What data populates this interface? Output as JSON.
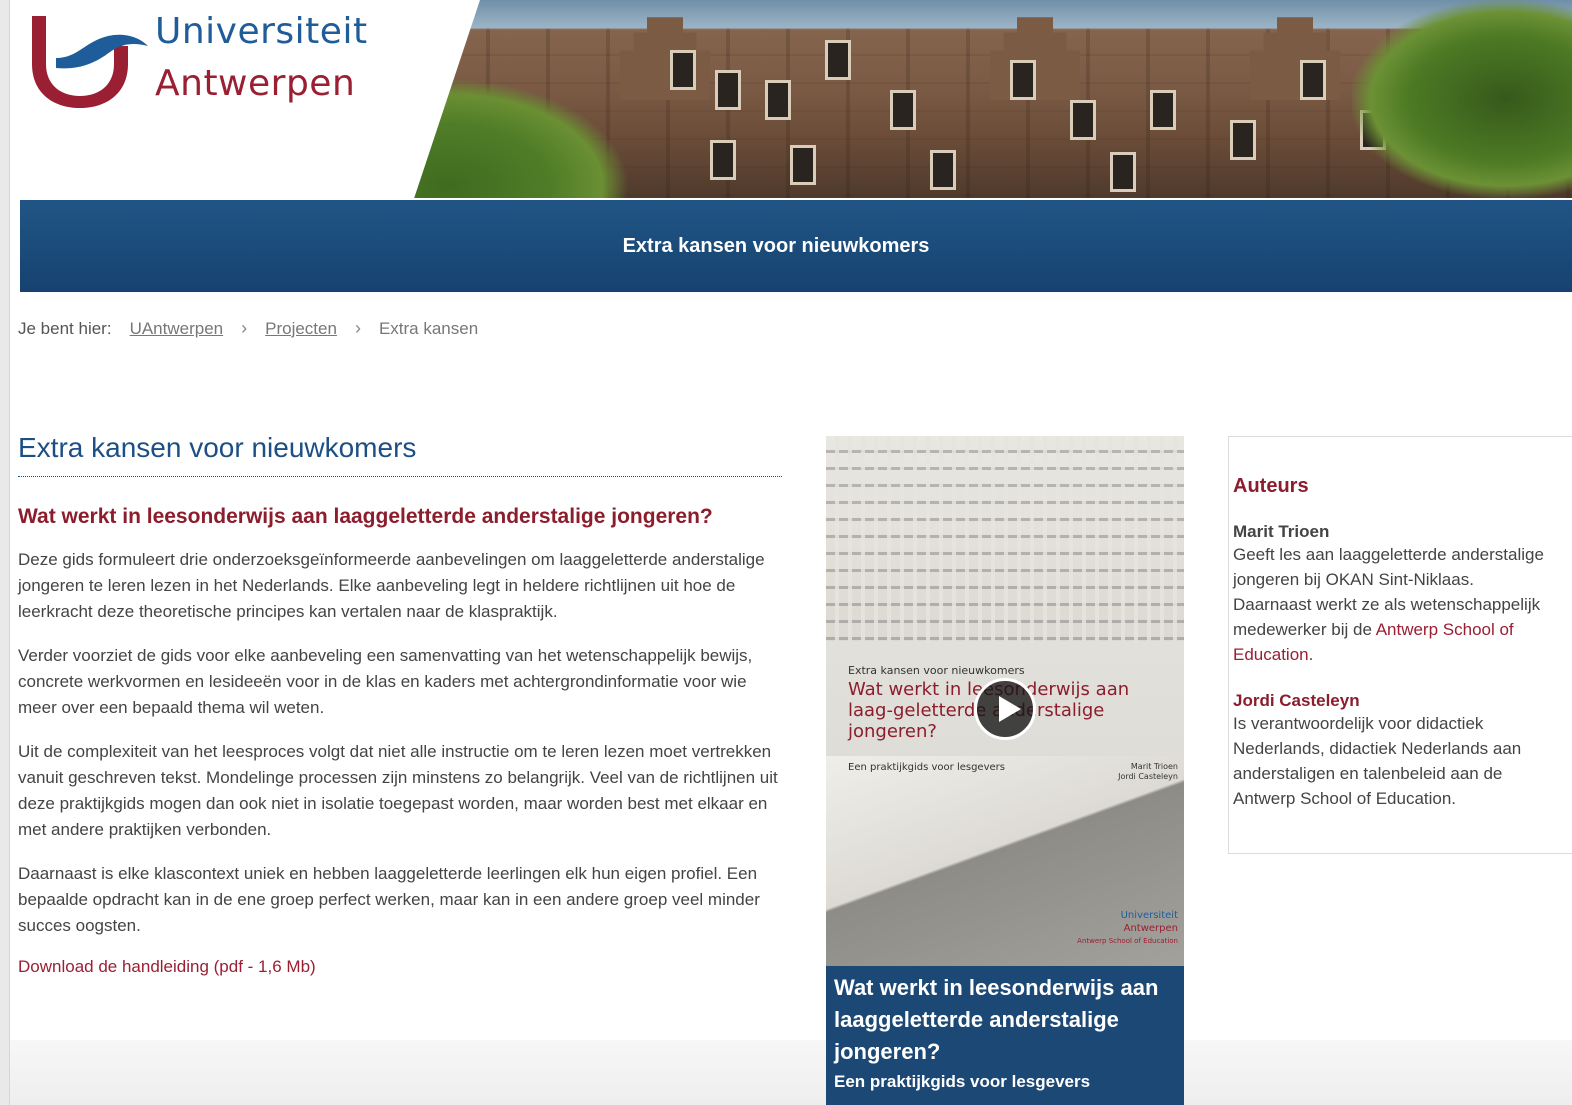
{
  "header": {
    "logo_line1": "Universiteit",
    "logo_line2": "Antwerpen",
    "brand_blue": "#1f5d9a",
    "brand_red": "#9a1f33"
  },
  "titlebar": {
    "title": "Extra kansen voor nieuwkomers",
    "color": "#1c4a78"
  },
  "breadcrumb": {
    "label": "Je bent hier:",
    "items": [
      {
        "label": "UAntwerpen",
        "link": true
      },
      {
        "label": "Projecten",
        "link": true
      },
      {
        "label": "Extra kansen",
        "link": false
      }
    ],
    "separator": "›"
  },
  "main": {
    "title": "Extra kansen voor nieuwkomers",
    "subtitle": "Wat werkt in leesonderwijs aan laaggeletterde anderstalige jongeren?",
    "paragraphs": [
      "Deze gids formuleert drie onderzoeksgeïnformeerde aanbevelingen om laaggeletterde anderstalige jongeren te leren lezen in het Nederlands. Elke aanbeveling legt in heldere richtlijnen uit hoe de leerkracht deze theoretische principes kan vertalen naar de klaspraktijk.",
      "Verder voorziet de gids voor elke aanbeveling een samenvatting van het wetenschappelijk bewijs, concrete werkvormen en lesideeën voor in de klas en kaders met achtergrondinformatie voor wie meer over een bepaald thema wil weten.",
      "Uit de complexiteit van het leesproces volgt dat niet alle instructie om te leren lezen moet vertrekken vanuit geschreven tekst. Mondelinge processen zijn minstens zo belangrijk. Veel van de richtlijnen uit deze praktijkgids mogen dan ook niet in isolatie toegepast worden, maar worden best met elkaar en met andere praktijken verbonden.",
      "Daarnaast is elke klascontext uniek en hebben laaggeletterde leerlingen elk hun eigen profiel. Een bepaalde opdracht kan in de ene groep perfect werken, maar kan in een andere groep veel minder succes oogsten."
    ],
    "download": "Download de handleiding (pdf - 1,6 Mb)"
  },
  "video": {
    "cover_small": "Extra kansen voor nieuwkomers",
    "cover_title": "Wat werkt in leesonderwijs aan laag-geletterde anderstalige jongeren?",
    "cover_guide": "Een praktijkgids voor lesgevers",
    "cover_author1": "Marit Trioen",
    "cover_author2": "Jordi Casteleyn",
    "cover_logo1": "Universiteit",
    "cover_logo2": "Antwerpen",
    "cover_logo3": "Antwerp School of Education",
    "caption_title": "Wat werkt in leesonderwijs aan laaggeletterde anderstalige jongeren?",
    "caption_sub": "Een praktijkgids voor lesgevers",
    "play_icon": "play-icon"
  },
  "aside": {
    "heading": "Auteurs",
    "authors": [
      {
        "name": "Marit Trioen",
        "bio_lines": [
          "Geeft les aan laaggeletterde anderstalige",
          "jongeren bij OKAN Sint-Niklaas.",
          "Daarnaast werkt ze als wetenschappelijk",
          "medewerker bij de "
        ],
        "link_part1": "Antwerp School of",
        "link_part2": "Education",
        "after_link": "."
      },
      {
        "name": "Jordi Casteleyn",
        "bio_lines": [
          "Is verantwoordelijk voor didactiek",
          "Nederlands, didactiek Nederlands aan",
          "anderstaligen en talenbeleid aan de",
          "Antwerp School of Education."
        ]
      }
    ]
  }
}
